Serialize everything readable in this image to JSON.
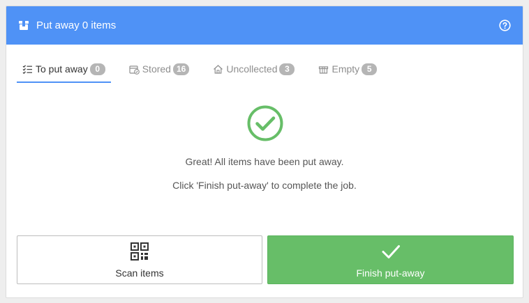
{
  "header": {
    "title": "Put away 0 items",
    "icon": "box-icon",
    "help_icon": "help-circle-icon",
    "color": "#4f92f6"
  },
  "tabs": [
    {
      "label": "To put away",
      "count": "0",
      "icon": "checklist-icon",
      "active": true
    },
    {
      "label": "Stored",
      "count": "16",
      "icon": "stored-box-icon",
      "active": false
    },
    {
      "label": "Uncollected",
      "count": "3",
      "icon": "home-icon",
      "active": false
    },
    {
      "label": "Empty",
      "count": "5",
      "icon": "empty-box-icon",
      "active": false
    }
  ],
  "status": {
    "icon": "check-circle-icon",
    "color": "#67be68",
    "message_1": "Great! All items have been put away.",
    "message_2": "Click 'Finish put-away' to complete the job."
  },
  "actions": {
    "scan_label": "Scan items",
    "scan_icon": "qr-code-icon",
    "finish_label": "Finish put-away",
    "finish_icon": "checkmark-icon",
    "finish_color": "#67be68"
  }
}
